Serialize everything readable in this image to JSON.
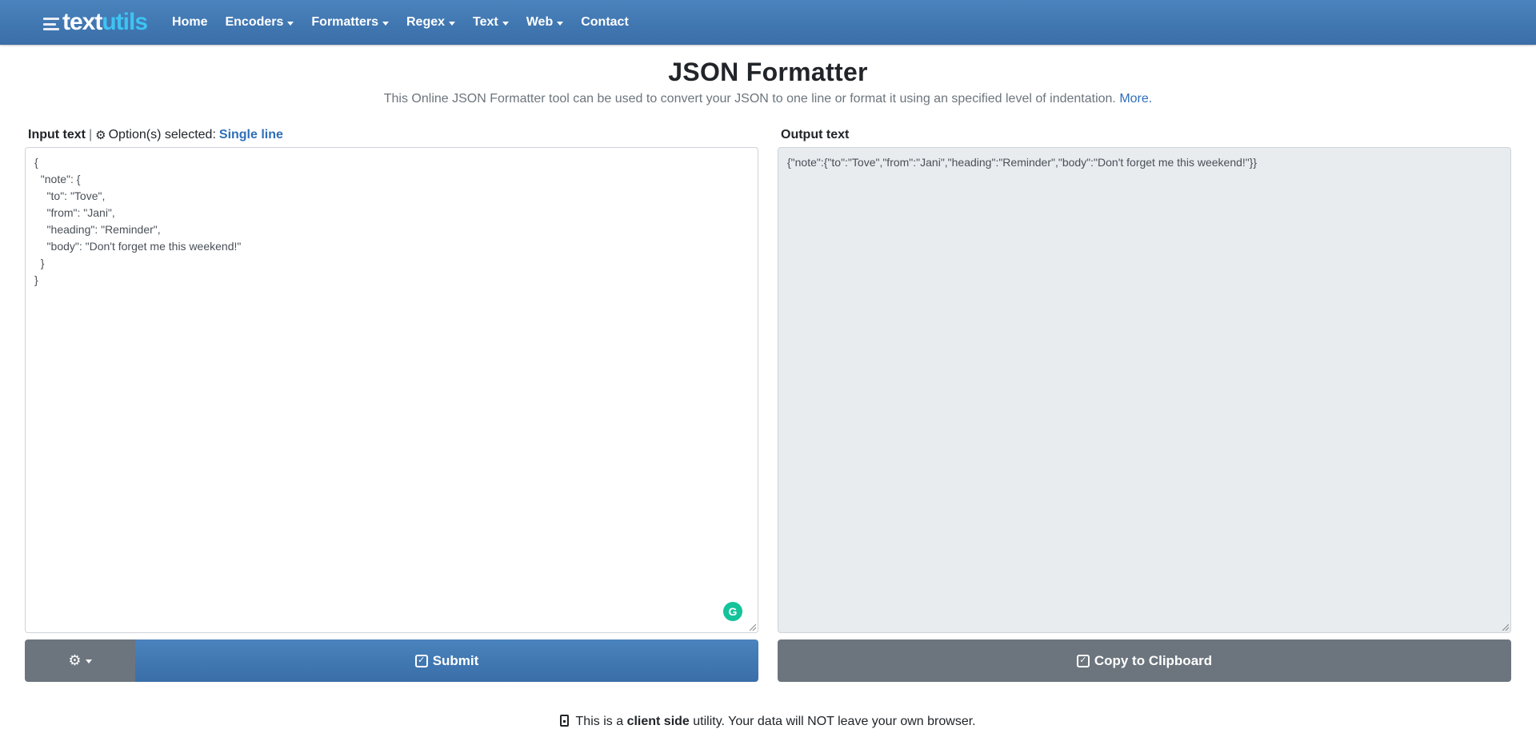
{
  "brand": {
    "part1": "text",
    "part2": "utils"
  },
  "nav": [
    {
      "label": "Home",
      "dropdown": false
    },
    {
      "label": "Encoders",
      "dropdown": true
    },
    {
      "label": "Formatters",
      "dropdown": true
    },
    {
      "label": "Regex",
      "dropdown": true
    },
    {
      "label": "Text",
      "dropdown": true
    },
    {
      "label": "Web",
      "dropdown": true
    },
    {
      "label": "Contact",
      "dropdown": false
    }
  ],
  "header": {
    "title": "JSON Formatter",
    "subtitle": "This Online JSON Formatter tool can be used to convert your JSON to one line or format it using an specified level of indentation.",
    "more_link": "More."
  },
  "input": {
    "label": "Input text",
    "separator": "|",
    "options_label": "Option(s) selected:",
    "options_value": "Single line",
    "value": "{\n  \"note\": {\n    \"to\": \"Tove\",\n    \"from\": \"Jani\",\n    \"heading\": \"Reminder\",\n    \"body\": \"Don't forget me this weekend!\"\n  }\n}"
  },
  "output": {
    "label": "Output text",
    "value": "{\"note\":{\"to\":\"Tove\",\"from\":\"Jani\",\"heading\":\"Reminder\",\"body\":\"Don't forget me this weekend!\"}}"
  },
  "buttons": {
    "submit_label": "Submit",
    "copy_label": "Copy to Clipboard"
  },
  "footer": {
    "prefix": "This is a",
    "bold": "client side",
    "suffix": "utility. Your data will NOT leave your own browser."
  },
  "icons": {
    "menu": "menu-icon",
    "gear": "gear-icon",
    "submit": "check-square-icon",
    "copy": "clipboard-icon",
    "lock": "lock-icon",
    "grammarly": "grammarly-icon"
  },
  "colors": {
    "navbar": "#3a6ea8",
    "accent": "#2f6fb8",
    "brand_accent": "#3ec3f2",
    "secondary": "#6c757d",
    "output_bg": "#e8ecef"
  }
}
